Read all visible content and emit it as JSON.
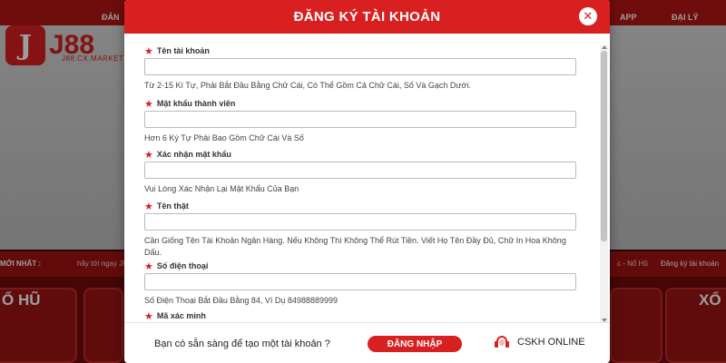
{
  "site": {
    "logo_mark": "J",
    "logo_text": "J88",
    "logo_sub": "J88.CX.MARKETING",
    "nav": [
      "ĐẢN",
      "APP",
      "ĐẠI LÝ"
    ],
    "ticker_label": "MỚI NHẤT :",
    "ticker_message": "hãy tới ngay J8",
    "ticker_right": "c - Nổ Hũ",
    "ticker_right2": "Đăng ký tài khoản",
    "game_left": "Ổ HŨ",
    "game_right": "XỔ"
  },
  "modal": {
    "title": "ĐĂNG KÝ TÀI KHOẢN",
    "close_symbol": "✕",
    "fields": [
      {
        "label": "Tên tài khoản",
        "value": "",
        "hint": "Từ 2-15 Kí Tự, Phải Bắt Đầu Bằng Chữ Cái, Có Thể Gồm Cả Chữ Cái, Số Và Gạch Dưới."
      },
      {
        "label": "Mật khẩu thành viên",
        "value": "",
        "hint": "Hơn 6 Ký Tự Phải Bao Gồm Chữ Cái Và Số"
      },
      {
        "label": "Xác nhận mật khẩu",
        "value": "",
        "hint": "Vui Lòng Xác Nhận Lại Mật Khẩu Của Bạn"
      },
      {
        "label": "Tên thật",
        "value": "",
        "hint": "Cần Giống Tên Tài Khoản Ngân Hàng. Nếu Không Thì Không Thể Rút Tiền. Viết Họ Tên Đầy Đủ, Chữ In Hoa Không Dấu."
      },
      {
        "label": "Số điện thoại",
        "value": "",
        "hint": "Số Điện Thoại Bắt Đầu Bằng 84, Ví Dụ 84988889999"
      },
      {
        "label": "Mã xác minh",
        "value": "",
        "hint": ""
      }
    ],
    "footer": {
      "question": "Bạn có sẵn sàng để tạo một tài khoản ?",
      "login_label": "ĐĂNG NHẬP",
      "support_label": "CSKH ONLINE"
    }
  },
  "colors": {
    "brand_red": "#d82020",
    "ticker_red": "#a01212"
  }
}
